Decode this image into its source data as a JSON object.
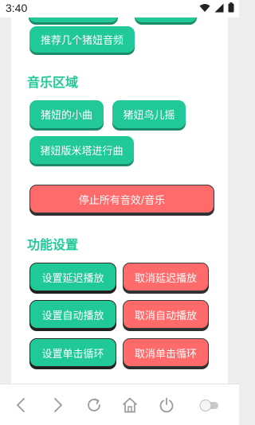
{
  "status_bar": {
    "time": "3:40"
  },
  "top_section": {
    "recommend_button": "推荐几个猪妞音频"
  },
  "music_section": {
    "title": "音乐区域",
    "songs": [
      "猪妞的小曲",
      "猪妞鸟儿摇",
      "猪妞版米塔进行曲"
    ],
    "stop_all_button": "停止所有音效/音乐"
  },
  "settings_section": {
    "title": "功能设置",
    "set_delay": "设置延迟播放",
    "cancel_delay": "取消延迟播放",
    "set_autoplay": "设置自动播放",
    "cancel_autoplay": "取消自动播放",
    "set_single_loop": "设置单击循环",
    "cancel_single_loop": "取消单击循环"
  },
  "colors": {
    "accent_green": "#20c997",
    "accent_red": "#ff6b6b"
  },
  "nav_icons": [
    "back-icon",
    "forward-icon",
    "reload-icon",
    "home-icon",
    "power-icon",
    "toggle-switch"
  ]
}
